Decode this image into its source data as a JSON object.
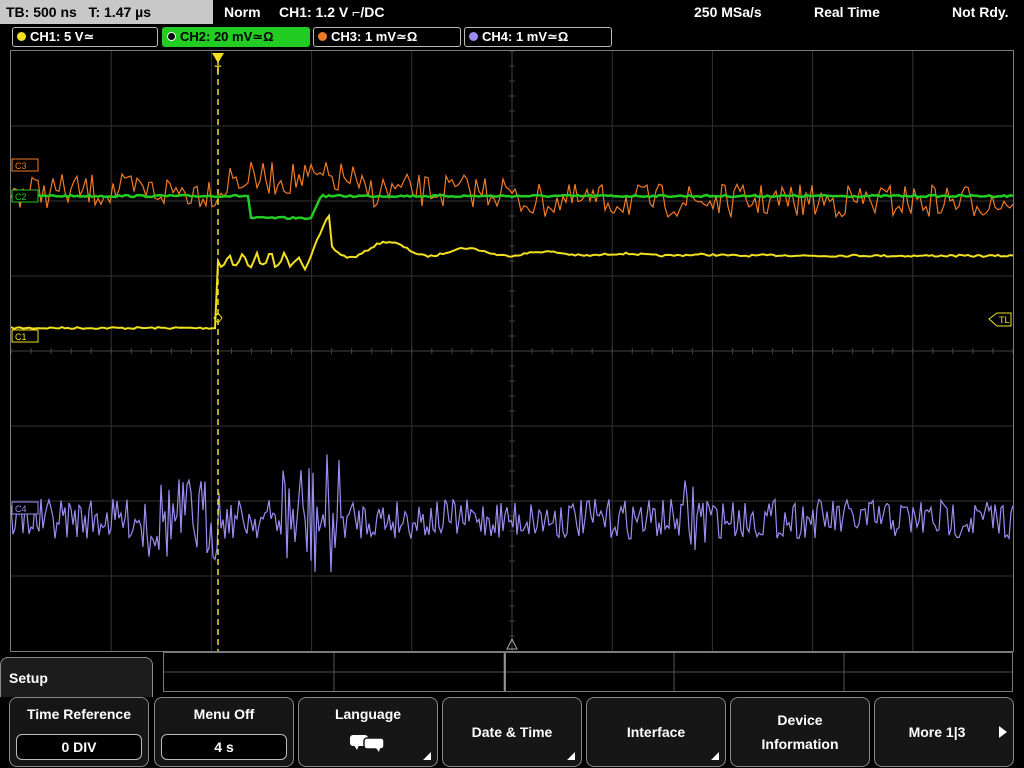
{
  "topbar": {
    "timebase": "TB: 500 ns   T: 1.47 µs",
    "mode": "Norm",
    "trigger": "CH1: 1.2 V ⌐/DC",
    "sample_rate": "250 MSa/s",
    "acq_mode": "Real Time",
    "status": "Not Rdy."
  },
  "channels": [
    {
      "label": "CH1: 5 V≃",
      "color": "#f0e020",
      "active": false
    },
    {
      "label": "CH2: 20 mV≃Ω",
      "color": "#22cc22",
      "active": true
    },
    {
      "label": "CH3: 1 mV≃Ω",
      "color": "#f07a24",
      "active": false
    },
    {
      "label": "CH4: 1 mV≃Ω",
      "color": "#9a8cf0",
      "active": false
    }
  ],
  "markers": {
    "c1": "C1",
    "c2": "C2",
    "c3": "C3",
    "c4": "C4",
    "trigger_level": "TL",
    "trigger_pos": "T"
  },
  "setup_label": "Setup",
  "softkeys": {
    "time_reference": {
      "label": "Time Reference",
      "value": "0 DIV"
    },
    "menu_off": {
      "label": "Menu Off",
      "value": "4 s"
    },
    "language": {
      "label": "Language",
      "icon": "speech-bubbles-icon"
    },
    "date_time": {
      "label": "Date & Time"
    },
    "interface": {
      "label": "Interface"
    },
    "device_info": {
      "label": "Device\nInformation"
    },
    "more": {
      "label": "More 1|3"
    }
  }
}
